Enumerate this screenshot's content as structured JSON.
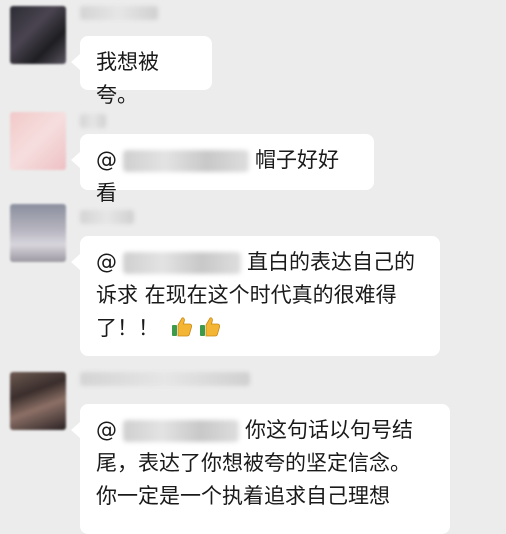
{
  "messages": [
    {
      "text": "我想被夸。"
    },
    {
      "at": "@",
      "text": "帽子好好看"
    },
    {
      "at": "@",
      "line1": "直白的表达自己的",
      "line2": "诉求 在现在这个时代真的很难得",
      "line3": "了！！"
    },
    {
      "at": "@",
      "line1": "你这句话以句号结",
      "line2": "尾，表达了你想被夸的坚定信念。",
      "line3": "你一定是一个执着追求自己理想"
    }
  ],
  "icons": {
    "thumbs_up": "thumbs-up-emoji"
  },
  "colors": {
    "background": "#ececec",
    "bubble": "#ffffff",
    "text": "#1a1a1a"
  }
}
